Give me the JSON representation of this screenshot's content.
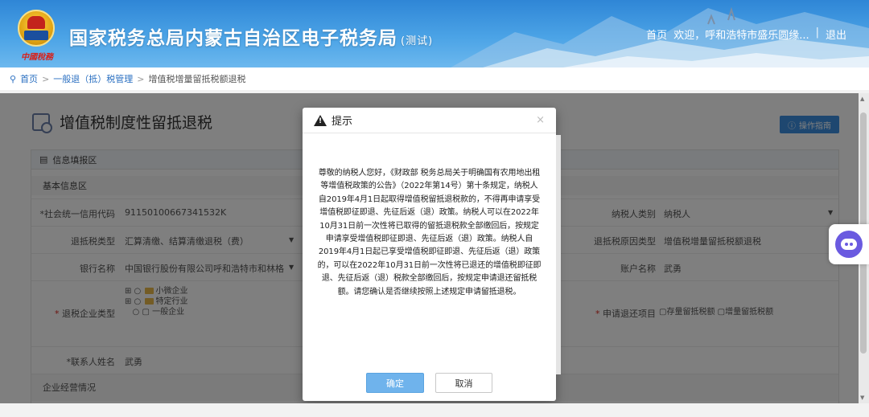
{
  "colors": {
    "brand_blue": "#2f86d6",
    "link_blue": "#2a6fc1",
    "ok_button": "#6fb3ec",
    "required": "#d9281f"
  },
  "header": {
    "seal_text": "中國稅務",
    "title": "国家税务总局内蒙古自治区电子税务局",
    "title_suffix": "(测试)",
    "nav_home": "首页",
    "welcome": "欢迎，呼和浩特市盛乐圆缘...",
    "separator": "|",
    "logout": "退出"
  },
  "breadcrumb": {
    "icon": "location-pin-icon",
    "home": "首页",
    "level1": "一般退（抵）税管理",
    "current": "增值税增量留抵税额退税",
    "sep": ">"
  },
  "page": {
    "title": "增值税制度性留抵退税",
    "op_button": "操作指南",
    "section_info": "信息填报区",
    "section_basic": "基本信息区",
    "section_business": "企业经营情况"
  },
  "form": {
    "credit_code_label": "*社会统一信用代码",
    "credit_code_value": "91150100667341532K",
    "taxpayer_type_label": "纳税人类别",
    "taxpayer_type_value": "纳税人",
    "refund_type_label": "退抵税类型",
    "refund_type_value": "汇算清缴、结算清缴退税（费）",
    "refund_reason_label": "退抵税原因类型",
    "refund_reason_value": "增值税增量留抵税额退税",
    "bank_label": "银行名称",
    "bank_value": "中国银行股份有限公司呼和浩特市和林格",
    "account_label": "账户名称",
    "account_value": "武勇",
    "enterprise_type_label": "退税企业类型",
    "enterprise_types": [
      "小微企业",
      "特定行业",
      "一般企业"
    ],
    "apply_item_label": "申请退还项目",
    "apply_items": [
      "存量留抵税额",
      "增量留抵税额"
    ],
    "contact_label": "*联系人姓名",
    "contact_value": "武勇"
  },
  "modal": {
    "title": "提示",
    "close": "×",
    "body": "尊敬的纳税人您好，《财政部 税务总局关于明确国有农用地出租等增值税政策的公告》（2022年第14号）第十条规定，纳税人自2019年4月1日起取得增值税留抵退税款的，不得再申请享受增值税即征即退、先征后返（退）政策。纳税人可以在2022年10月31日前一次性将已取得的留抵退税款全部缴回后，按规定申请享受增值税即征即退、先征后返（退）政策。纳税人自2019年4月1日起已享受增值税即征即退、先征后返（退）政策的，可以在2022年10月31日前一次性将已退还的增值税即征即退、先征后返（退）税款全部缴回后，按规定申请退还留抵税额。请您确认是否继续按照上述规定申请留抵退税。",
    "ok": "确定",
    "cancel": "取消"
  }
}
